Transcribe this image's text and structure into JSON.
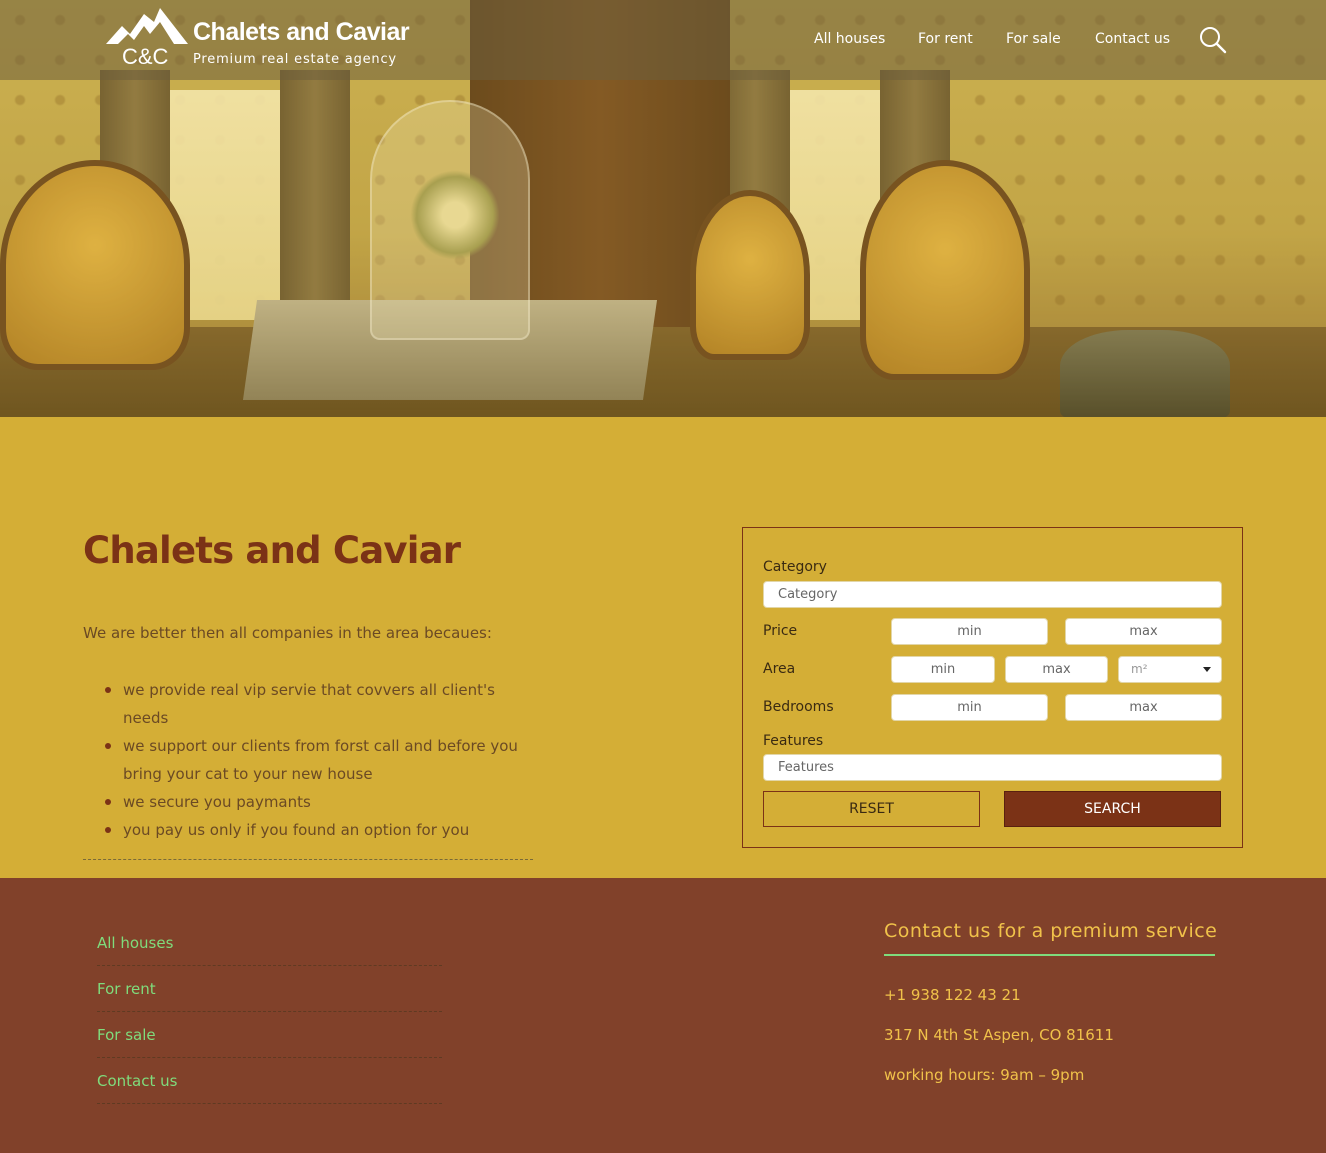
{
  "brand": {
    "logo_mark": "C&C",
    "title": "Chalets and Caviar",
    "tagline": "Premium real estate agency"
  },
  "nav": {
    "items": [
      "All houses",
      "For rent",
      "For sale",
      "Contact us"
    ],
    "search_icon": "search-icon"
  },
  "intro": {
    "title": "Chalets and Caviar",
    "lead": "We are better then all companies in the area becaues:",
    "points": [
      "we provide real vip servie that covvers all client's needs",
      "we support our clients from forst call and before you bring your cat to your new house",
      "we secure you paymants",
      "you pay us only if you found an option for you"
    ]
  },
  "search_form": {
    "category_label": "Category",
    "category_placeholder": "Category",
    "price_label": "Price",
    "area_label": "Area",
    "bedrooms_label": "Bedrooms",
    "features_label": "Features",
    "features_placeholder": "Features",
    "min_placeholder": "min",
    "max_placeholder": "max",
    "area_unit": "m²",
    "reset_label": "RESET",
    "search_label": "SEARCH"
  },
  "footer": {
    "links": [
      "All houses",
      "For rent",
      "For sale",
      "Contact us"
    ],
    "contact_title": "Contact us for a premium service",
    "phone": "+1 938 122 43 21",
    "address": "317 N 4th St Aspen, CO 81611",
    "hours": "working hours: 9am – 9pm"
  },
  "colors": {
    "page_bg": "#d4ae36",
    "brand_brown": "#7b3216",
    "footer_bg": "#81412a",
    "footer_link": "#7fdc7c",
    "footer_accent": "#f0c24a"
  }
}
